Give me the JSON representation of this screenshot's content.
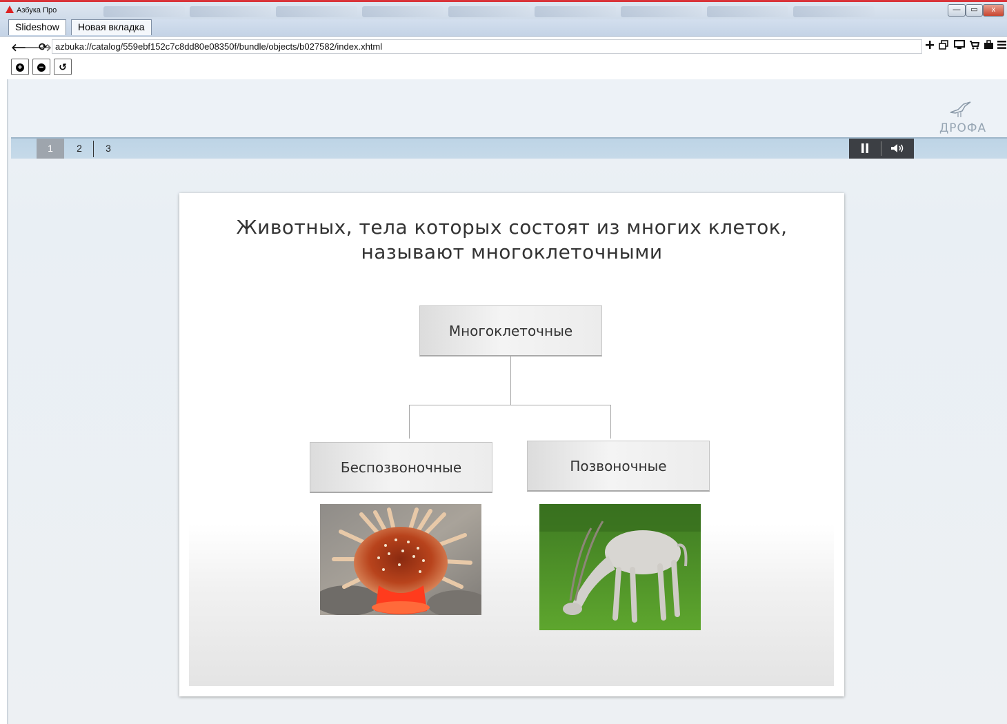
{
  "window": {
    "title": "Азбука Про",
    "controls": {
      "minimize": "—",
      "maximize": "▭",
      "close": "x"
    }
  },
  "tabs": [
    {
      "label": "Slideshow"
    },
    {
      "label": "Новая вкладка"
    }
  ],
  "toolbar": {
    "url": "azbuka://catalog/559ebf152c7c8dd80e08350f/bundle/objects/b027582/index.xhtml",
    "back_icon": "🡐",
    "forward_icon": "🡒",
    "reload_icon": "⟳",
    "zoom_in": "+",
    "zoom_out": "−",
    "zoom_reset": "↺"
  },
  "brand": {
    "name": "ДРОФА"
  },
  "pager": {
    "pages": [
      "1",
      "2",
      "3"
    ],
    "active_page": "1"
  },
  "slide": {
    "title_line1": "Животных, тела которых состоят из многих клеток,",
    "title_line2": "называют многоклеточными",
    "root_node": "Многоклеточные",
    "left_node": "Беспозвоночные",
    "right_node": "Позвоночные"
  },
  "colors": {
    "accent_red": "#d9343a",
    "pager_bg": "#c2d7e8",
    "media_bg": "#3c3f44",
    "active_page_bg": "#9ea5ad"
  }
}
